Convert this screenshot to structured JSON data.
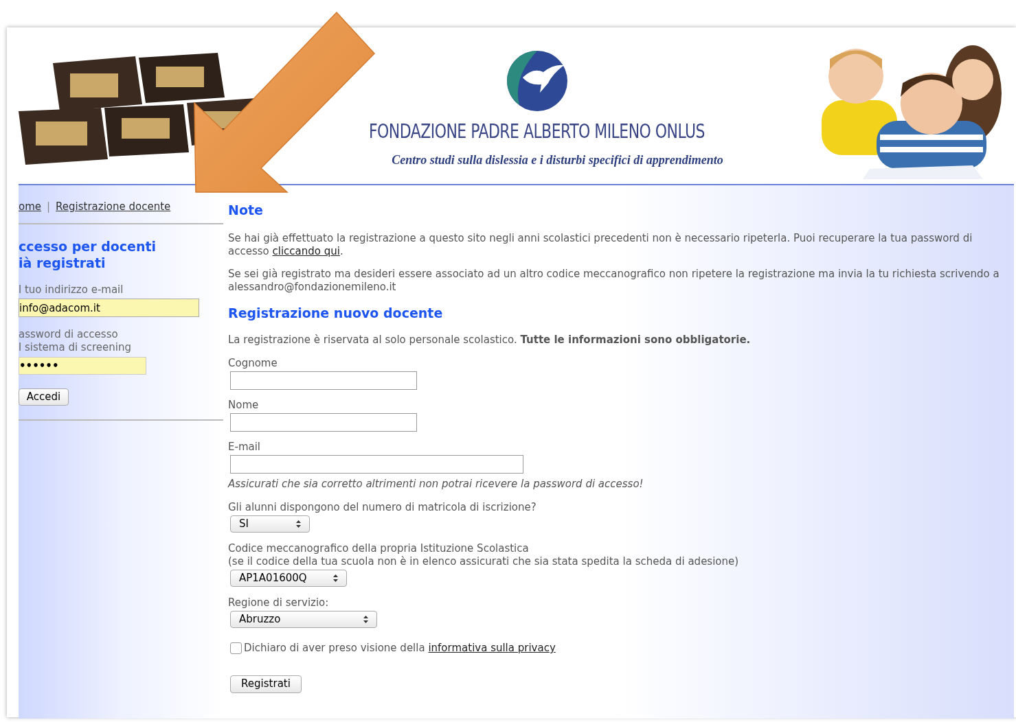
{
  "header": {
    "title": "FONDAZIONE PADRE ALBERTO MILENO ONLUS",
    "subtitle": "Centro studi sulla dislessia e i disturbi specifici di apprendimento"
  },
  "breadcrumb": {
    "items": [
      "ome",
      "Registrazione docente"
    ],
    "separator": "|"
  },
  "login": {
    "heading_lines": [
      "ccesso per docenti",
      "ià registrati"
    ],
    "email_label": "l tuo indirizzo e-mail",
    "email_value": "info@adacom.it",
    "password_label_lines": [
      "assword di accesso",
      "l sistema di screening"
    ],
    "password_value": "••••••",
    "button": "Accedi"
  },
  "note": {
    "heading": "Note",
    "paragraphs": [
      {
        "before": "Se hai già effettuato la registrazione a questo sito negli anni scolastici precedenti non è necessario ripeterla. Puoi recuperare la tua password di accesso ",
        "link": "cliccando qui",
        "after": "."
      },
      {
        "before": "Se sei già registrato ma desideri essere associato ad un altro codice meccanografico non ripetere la registrazione ma invia la tu richiesta scrivendo a alessandro@fondazionemileno.it"
      }
    ]
  },
  "registration": {
    "heading": "Registrazione nuovo docente",
    "intro": "La registrazione è riservata al solo personale scolastico. **Tutte le informazioni sono obbligatorie.**",
    "fields": [
      {
        "kind": "text",
        "label_lines": [
          "Cognome"
        ]
      },
      {
        "kind": "text",
        "label_lines": [
          "Nome"
        ]
      },
      {
        "kind": "text",
        "label_lines": [
          "E-mail"
        ],
        "hint": "Assicurati che sia corretto altrimenti non potrai ricevere la password di accesso!"
      },
      {
        "kind": "select",
        "label_lines": [
          "Gli alunni dispongono del numero di matricola di iscrizione?"
        ],
        "value": "SI"
      },
      {
        "kind": "select",
        "label_lines": [
          "Codice meccanografico della propria Istituzione Scolastica",
          "(se il codice della tua scuola non è in elenco assicurati che sia stata spedita la scheda di adesione)"
        ],
        "value": "AP1A01600Q"
      },
      {
        "kind": "select",
        "label_lines": [
          "Regione di servizio:"
        ],
        "value": "Abruzzo"
      }
    ],
    "privacy": {
      "checked": false,
      "label": "Dichiaro di aver preso visione della ",
      "link": "informativa sulla privacy"
    },
    "submit": "Registrati"
  }
}
